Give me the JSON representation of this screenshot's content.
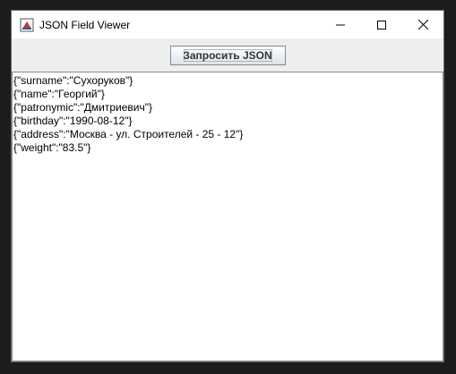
{
  "window": {
    "title": "JSON Field Viewer",
    "icons": {
      "app": "java-app-icon",
      "minimize": "minimize-icon",
      "maximize": "maximize-icon",
      "close": "close-icon"
    }
  },
  "toolbar": {
    "request_button_label": "Запросить JSON"
  },
  "output": {
    "lines": [
      "{\"surname\":\"Сухоруков\"}",
      "{\"name\":\"Георгий\"}",
      "{\"patronymic\":\"Дмитриевич\"}",
      "{\"birthday\":\"1990-08-12\"}",
      "{\"address\":\"Москва - ул. Строителей - 25 - 12\"}",
      "{\"weight\":\"83.5\"}"
    ]
  },
  "colors": {
    "titlebar_bg": "#ffffff",
    "window_bg": "#eeeeee",
    "text_area_bg": "#ffffff",
    "screen_bg": "#1c1c1c"
  }
}
